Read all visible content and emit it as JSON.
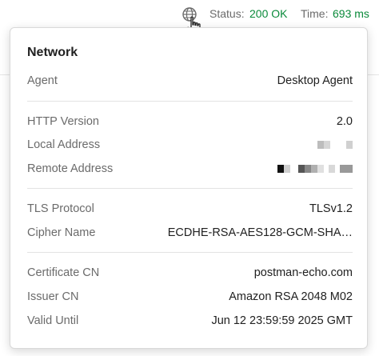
{
  "statusbar": {
    "globe_icon": "globe-icon",
    "status_label": "Status:",
    "status_value": "200 OK",
    "time_label": "Time:",
    "time_value": "693 ms",
    "status_color": "#0a8a3a"
  },
  "network": {
    "title": "Network",
    "agent": {
      "label": "Agent",
      "value": "Desktop Agent"
    },
    "http_version": {
      "label": "HTTP Version",
      "value": "2.0"
    },
    "local_address": {
      "label": "Local Address",
      "value": ""
    },
    "remote_address": {
      "label": "Remote Address",
      "value": ""
    },
    "tls_protocol": {
      "label": "TLS Protocol",
      "value": "TLSv1.2"
    },
    "cipher_name": {
      "label": "Cipher Name",
      "value": "ECDHE-RSA-AES128-GCM-SHA…"
    },
    "certificate_cn": {
      "label": "Certificate CN",
      "value": "postman-echo.com"
    },
    "issuer_cn": {
      "label": "Issuer CN",
      "value": "Amazon RSA 2048 M02"
    },
    "valid_until": {
      "label": "Valid Until",
      "value": "Jun 12 23:59:59 2025 GMT"
    }
  }
}
